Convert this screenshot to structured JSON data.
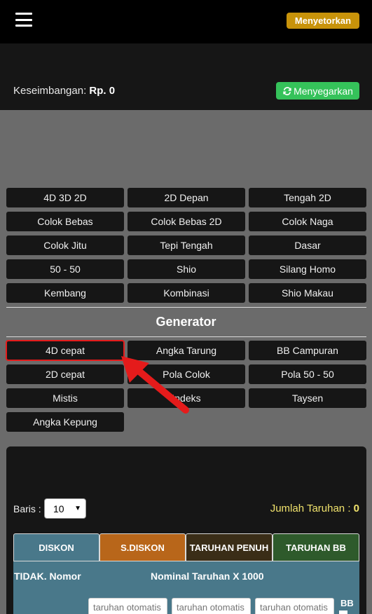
{
  "header": {
    "menu_icon": "hamburger-menu-icon",
    "deposit_label": "Menyetorkan"
  },
  "balance": {
    "label": "Keseimbangan:",
    "value": "Rp. 0",
    "refresh_label": "Menyegarkan",
    "refresh_icon": "refresh-icon",
    "refresh_color": "#35c25a"
  },
  "bet_types": [
    "4D 3D 2D",
    "2D Depan",
    "Tengah 2D",
    "Colok Bebas",
    "Colok Bebas 2D",
    "Colok Naga",
    "Colok Jitu",
    "Tepi Tengah",
    "Dasar",
    "50 - 50",
    "Shio",
    "Silang Homo",
    "Kembang",
    "Kombinasi",
    "Shio Makau"
  ],
  "generator": {
    "title": "Generator",
    "items": [
      "4D cepat",
      "Angka Tarung",
      "BB Campuran",
      "2D cepat",
      "Pola Colok",
      "Pola 50 - 50",
      "Mistis",
      "Indeks",
      "Taysen",
      "Angka Kepung"
    ],
    "selected": "4D cepat",
    "highlight_color": "#e51b1b"
  },
  "form": {
    "baris_label": "Baris :",
    "baris_value": "10",
    "jumlah_label": "Jumlah Taruhan :",
    "jumlah_value": "0",
    "tabs": [
      "DISKON",
      "S.DISKON",
      "TARUHAN PENUH",
      "TARUHAN BB"
    ],
    "table_headers": [
      "TIDAK. Nomor",
      "Nominal Taruhan X 1000"
    ],
    "input_placeholder": "taruhan otomatis",
    "bb_label": "BB"
  }
}
